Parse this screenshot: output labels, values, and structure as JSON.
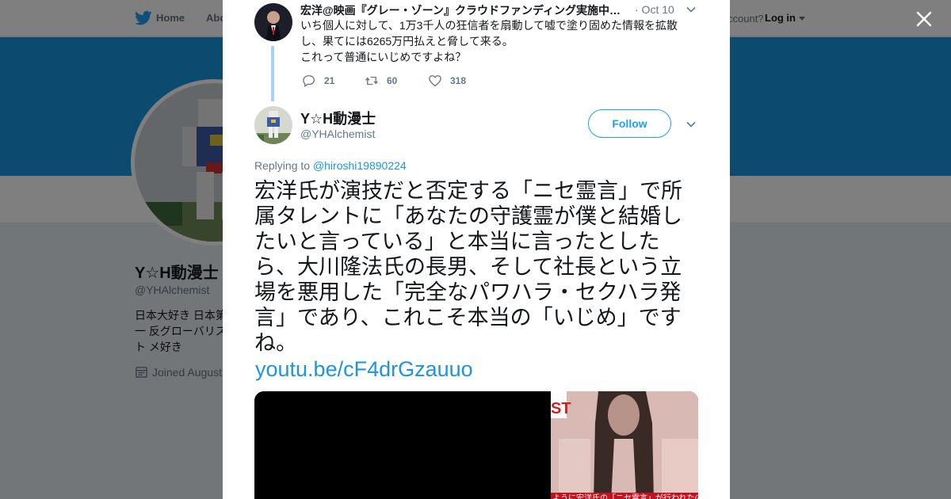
{
  "nav": {
    "home_label": "Home",
    "about_label": "Abo",
    "account_prompt": "ccount?",
    "login_label": "Log in"
  },
  "profile": {
    "name": "Y☆H動漫士",
    "handle": "@YHAlchemist",
    "bio": "日本大好き 日本第一 反グローバリスト メ好き",
    "joined": "Joined August"
  },
  "parent_tweet": {
    "author": "宏洋@映画『グレー・ゾーン』クラウドファンディング実施中…",
    "time": "· Oct 10",
    "text_lines": [
      "いち個人に対して、1万3千人の狂信者を扇動して嘘で塗り固めた情報を拡散",
      "し、果てには6265万円払えと脅して来る。",
      "これって普通にいじめですよね？"
    ],
    "replies": "21",
    "retweets": "60",
    "likes": "318"
  },
  "main_tweet": {
    "name": "Y☆H動漫士",
    "handle": "@YHAlchemist",
    "follow_label": "Follow",
    "replying_prefix": "Replying to",
    "replying_to": "@hiroshi19890224",
    "text": "宏洋氏が演技だと否定する「ニセ霊言」で所属タレントに「あなたの守護霊が僕と結婚したいと言っている」と本当に言ったとしたら、大川隆法氏の長男、そして社長という立場を悪用した「完全なパワハラ・セクハラ発言」であり、これこそ本当の「いじめ」ですね。",
    "link": "youtu.be/cF4drGzauuo"
  },
  "media": {
    "caption_fragment": "ように宏洋氏の「ニセ霊言」が行われたのか？"
  },
  "colors": {
    "accent": "#1da1f2",
    "banner": "#1b95e0",
    "thread_line": "#a6d4f2"
  }
}
